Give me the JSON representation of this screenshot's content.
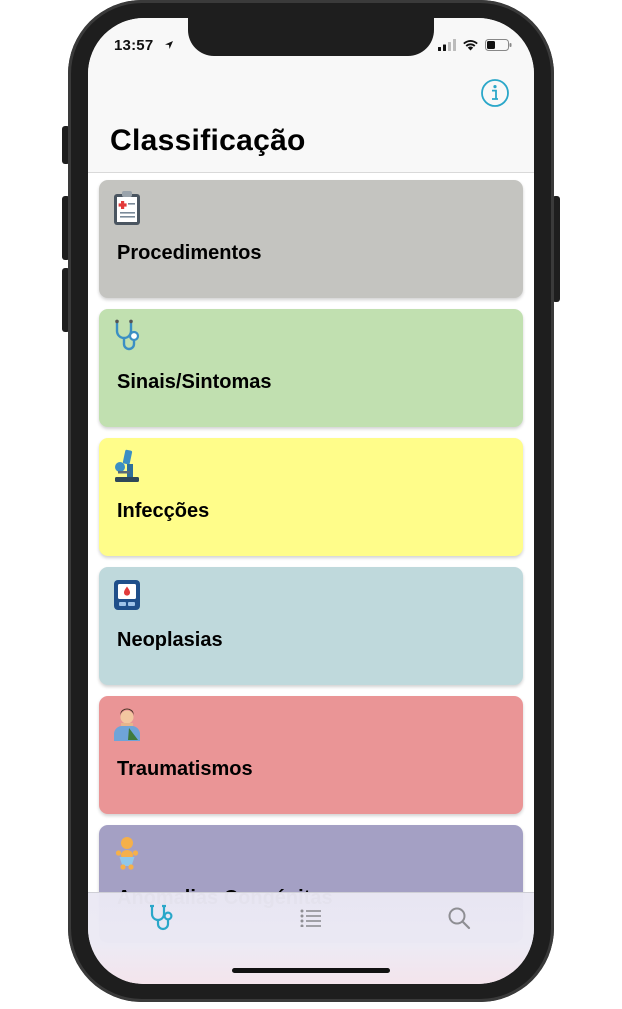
{
  "status_bar": {
    "time": "13:57",
    "icons": [
      "location-arrow-icon",
      "cellular-signal-icon",
      "wifi-icon",
      "battery-icon"
    ]
  },
  "nav": {
    "title": "Classificação",
    "info_icon": "info-circle-icon"
  },
  "categories": [
    {
      "label": "Procedimentos",
      "icon": "clipboard-medical-icon",
      "color": "#c4c4c0"
    },
    {
      "label": "Sinais/Sintomas",
      "icon": "stethoscope-icon",
      "color": "#c1e0b0"
    },
    {
      "label": "Infecções",
      "icon": "microscope-icon",
      "color": "#fffd8a"
    },
    {
      "label": "Neoplasias",
      "icon": "blood-test-device-icon",
      "color": "#bfd9dc"
    },
    {
      "label": "Traumatismos",
      "icon": "injured-person-icon",
      "color": "#ea9596"
    },
    {
      "label": "Anomalias Congénitas",
      "icon": "baby-icon",
      "color": "#a4a0c4"
    }
  ],
  "tab_bar": {
    "tabs": [
      {
        "icon": "stethoscope-icon",
        "selected": true
      },
      {
        "icon": "list-icon",
        "selected": false
      },
      {
        "icon": "search-icon",
        "selected": false
      }
    ],
    "accent_color": "#2aa7c9",
    "inactive_color": "#8e8e93"
  }
}
